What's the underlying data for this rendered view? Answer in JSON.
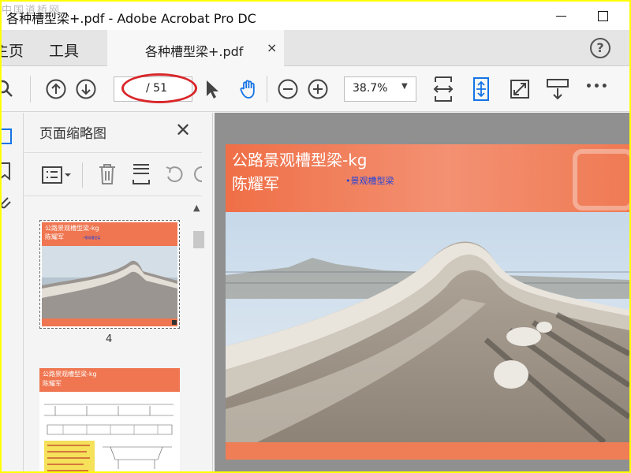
{
  "window": {
    "title": "各种槽型梁+.pdf - Adobe Acrobat Pro DC",
    "watermark": "中国道桥网"
  },
  "tabs": {
    "home": "主页",
    "tools": "工具",
    "document": "各种槽型梁+.pdf",
    "close_glyph": "×",
    "help_glyph": "?"
  },
  "toolbar": {
    "current_page": "",
    "total_pages": "/ 51",
    "zoom": "38.7%",
    "more_glyph": "•••"
  },
  "panel": {
    "title": "页面缩略图",
    "close_glyph": "✕",
    "thumbnails": [
      {
        "page_label": "4"
      },
      {
        "page_label": ""
      }
    ]
  },
  "slide": {
    "title_line1": "公路景观槽型梁-kg",
    "title_line2": "陈耀军",
    "subtitle": "•景观槽型梁"
  },
  "colors": {
    "accent_blue": "#1473e6",
    "highlight_red": "#d9262a",
    "slide_orange": "#f08a62"
  }
}
